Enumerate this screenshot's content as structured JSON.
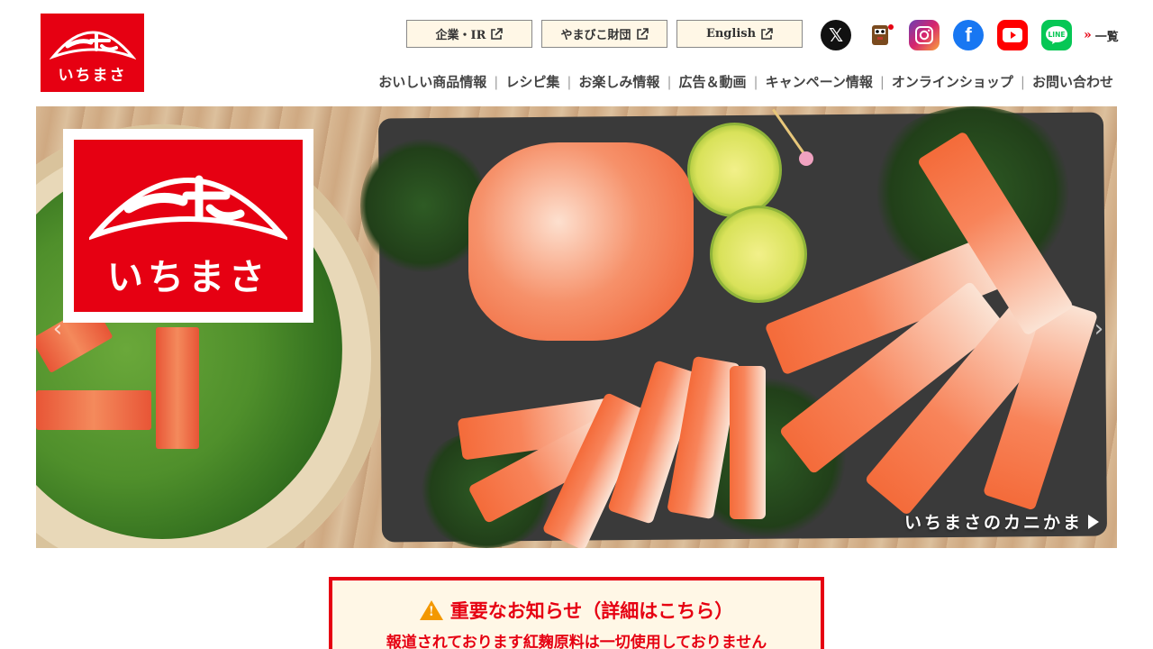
{
  "brand": {
    "logo_text": "いちまさ",
    "accent_color": "#e60012"
  },
  "top_buttons": [
    {
      "label": "企業・IR",
      "icon": "external-link-icon"
    },
    {
      "label": "やまびこ財団",
      "icon": "external-link-icon"
    },
    {
      "label": "English",
      "icon": "external-link-icon"
    }
  ],
  "social": {
    "icons": [
      "x-icon",
      "mascot-icon",
      "instagram-icon",
      "facebook-icon",
      "youtube-icon",
      "line-icon"
    ],
    "line_label": "LINE",
    "more_label": "一覧"
  },
  "nav": {
    "items": [
      "おいしい商品情報",
      "レシピ集",
      "お楽しみ情報",
      "広告＆動画",
      "キャンペーン情報",
      "オンラインショップ",
      "お問い合わせ"
    ]
  },
  "hero": {
    "logo_text": "いちまさ",
    "caption": "いちまさのカニかま"
  },
  "notice": {
    "title": "重要なお知らせ（詳細はこちら）",
    "subtitle": "報道されております紅麹原料は一切使用しておりません"
  }
}
